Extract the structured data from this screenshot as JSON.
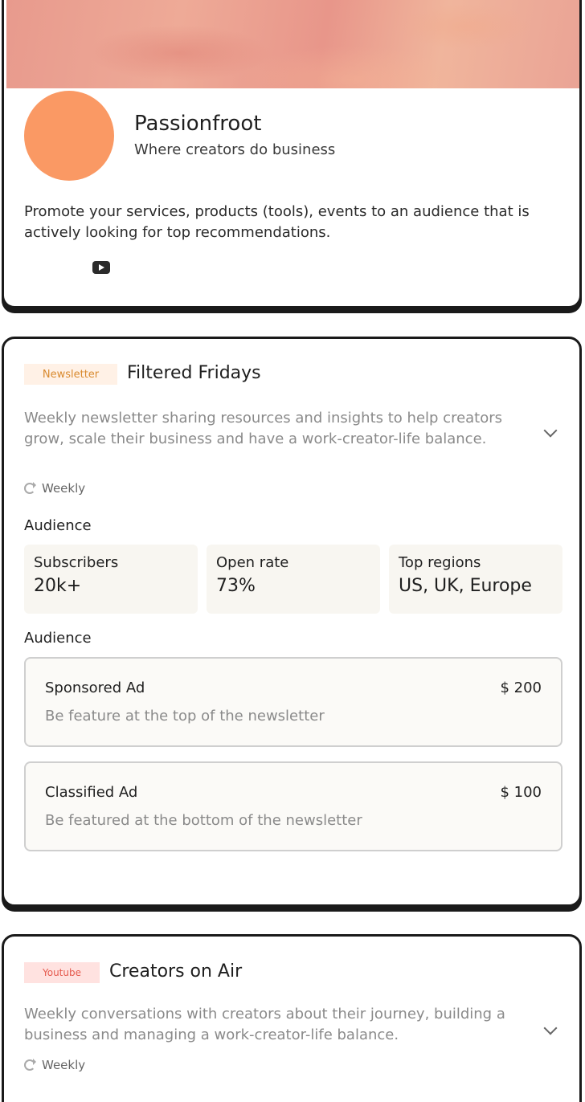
{
  "profile": {
    "name": "Passionfroot",
    "tagline": "Where creators do business",
    "description": "Promote your services, products (tools), events to an audience that is actively looking for top recommendations.",
    "avatar_color": "#fa9964"
  },
  "newsletter": {
    "badge": "Newsletter",
    "title": "Filtered Fridays",
    "description": "Weekly newsletter sharing resources and insights to help creators grow, scale their business and have a work-creator-life balance.",
    "frequency": "Weekly",
    "audience_label": "Audience",
    "stats": [
      {
        "label": "Subscribers",
        "value": "20k+"
      },
      {
        "label": "Open rate",
        "value": "73%"
      },
      {
        "label": "Top regions",
        "value": "US, UK, Europe"
      }
    ],
    "offers_label": "Audience",
    "offers": [
      {
        "name": "Sponsored Ad",
        "price": "$ 200",
        "description": "Be feature at the top of the newsletter"
      },
      {
        "name": "Classified Ad",
        "price": "$ 100",
        "description": "Be featured at the bottom of the newsletter"
      }
    ]
  },
  "youtube": {
    "badge": "Youtube",
    "title": "Creators on Air",
    "description": "Weekly conversations with creators about their journey, building a business and managing a work-creator-life balance.",
    "frequency": "Weekly"
  },
  "colors": {
    "newsletter_badge_bg": "#fff1e6",
    "newsletter_badge_text": "#d98a2f",
    "youtube_badge_bg": "#ffe2e0",
    "youtube_badge_text": "#e55a4e"
  }
}
